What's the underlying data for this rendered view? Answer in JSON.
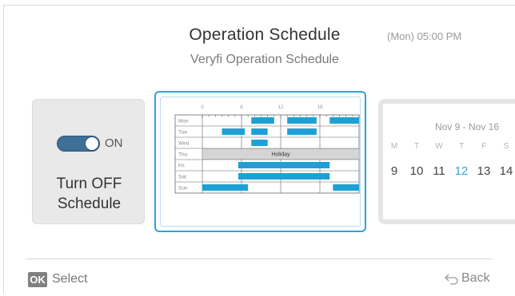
{
  "header": {
    "title": "Operation Schedule",
    "subtitle": "Veryfi Operation Schedule",
    "datetime": "(Mon) 05:00 PM"
  },
  "toggle_card": {
    "toggle_state": "ON",
    "action_label_line1": "Turn OFF",
    "action_label_line2": "Schedule"
  },
  "schedule": {
    "hour_ticks": [
      "0",
      "6",
      "12",
      "18"
    ],
    "days": [
      "Mon",
      "Tue",
      "Wed",
      "Thu",
      "Fri",
      "Sat",
      "Sun"
    ],
    "holiday_label": "Holiday",
    "holiday_day": "Thu",
    "blocks": [
      {
        "day": "Mon",
        "start": 7.5,
        "end": 11
      },
      {
        "day": "Mon",
        "start": 13,
        "end": 17.5
      },
      {
        "day": "Mon",
        "start": 19.5,
        "end": 24
      },
      {
        "day": "Tue",
        "start": 3,
        "end": 6.5
      },
      {
        "day": "Tue",
        "start": 7.5,
        "end": 10
      },
      {
        "day": "Tue",
        "start": 13,
        "end": 17.5
      },
      {
        "day": "Wed",
        "start": 7.5,
        "end": 10
      },
      {
        "day": "Fri",
        "start": 5.5,
        "end": 19.5
      },
      {
        "day": "Sat",
        "start": 5.5,
        "end": 19.5
      },
      {
        "day": "Sun",
        "start": 0,
        "end": 7
      },
      {
        "day": "Sun",
        "start": 20,
        "end": 24
      }
    ],
    "block_color": "#1ea0d6",
    "holiday_color": "#d5d5d5"
  },
  "calendar": {
    "range": "Nov 9 - Nov 16",
    "weekdays": [
      "M",
      "T",
      "W",
      "T",
      "F",
      "S"
    ],
    "dates": [
      "9",
      "10",
      "11",
      "12",
      "13",
      "14"
    ],
    "today": "12"
  },
  "footer": {
    "ok_badge": "OK",
    "select_label": "Select",
    "back_label": "Back"
  },
  "colors": {
    "accent": "#2ea3d3",
    "toggle_on": "#3f6e96"
  }
}
